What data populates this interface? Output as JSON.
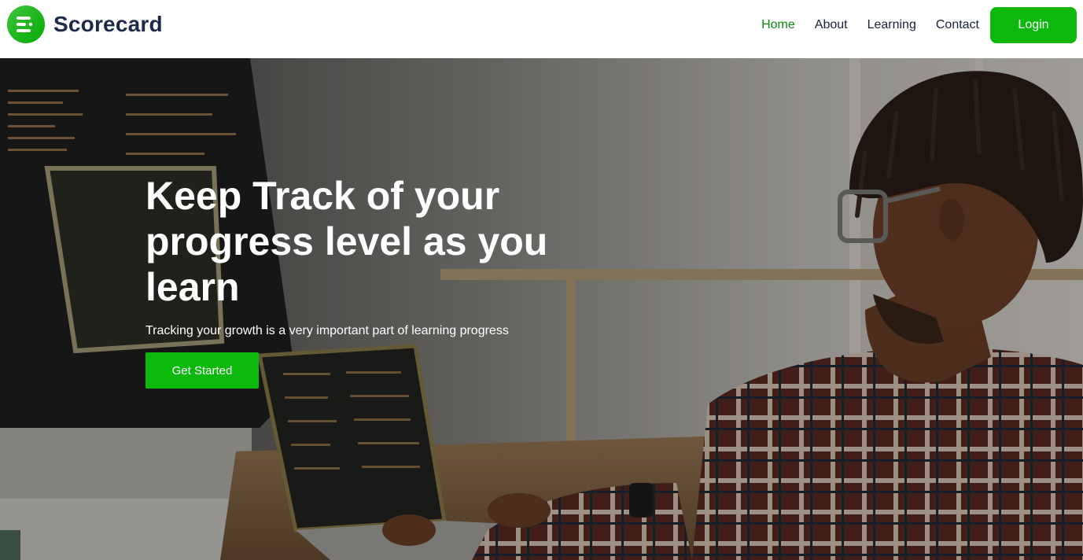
{
  "brand": {
    "name": "Scorecard",
    "logo_icon": "list-lines-icon",
    "accent_color": "#0cb80c"
  },
  "nav": {
    "items": [
      {
        "label": "Home",
        "active": true
      },
      {
        "label": "About",
        "active": false
      },
      {
        "label": "Learning",
        "active": false
      },
      {
        "label": "Contact",
        "active": false
      }
    ],
    "login_label": "Login"
  },
  "hero": {
    "title": "Keep Track of your progress level as you learn",
    "subtitle": "Tracking your growth is a very important part of learning progress",
    "cta_label": "Get Started"
  }
}
